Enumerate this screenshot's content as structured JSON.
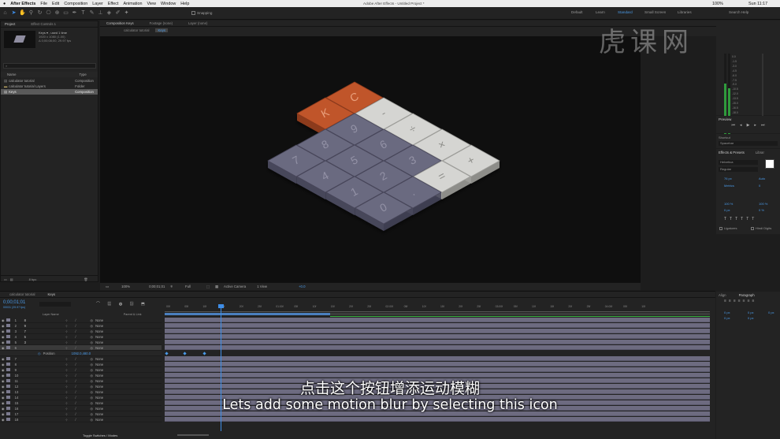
{
  "menubar": {
    "items": [
      "After Effects",
      "File",
      "Edit",
      "Composition",
      "Layer",
      "Effect",
      "Animation",
      "View",
      "Window",
      "Help"
    ],
    "title": "Adobe After Effects - Untitled Project *",
    "status": "100%",
    "clock": "Sun 11:17"
  },
  "toolbar": {
    "snapping": "Snapping",
    "workspaces": [
      "Default",
      "Learn",
      "Standard",
      "Small Screen",
      "Libraries"
    ],
    "search": "Search Help"
  },
  "project": {
    "tabs": [
      "Project",
      "Effect Controls 1"
    ],
    "item_name": "Keys ▾ , used 1 time",
    "item_size": "1920 x 1080 (1.00)",
    "item_duration": "Δ 0;00;08;00, 29.97 fps",
    "search_placeholder": "⌕",
    "col_name": "Name",
    "col_type": "Type",
    "rows": [
      {
        "name": "calculator tutorial",
        "type": "Composition"
      },
      {
        "name": "calculator tutorial Layers",
        "type": "Folder"
      },
      {
        "name": "Keys",
        "type": "Composition"
      }
    ],
    "footer": "8 bpc"
  },
  "comp": {
    "tabs": [
      "Composition Keys",
      "Footage (none)",
      "Layer (none)"
    ],
    "subtabs": [
      "calculator tutorial",
      "Keys"
    ],
    "keys": {
      "k": "K",
      "c": "C",
      "minus": "-",
      "div": "÷",
      "times": "×",
      "plus": "+",
      "eq": "=",
      "n7": "7",
      "n8": "8",
      "n9": "9",
      "n4": "4",
      "n5": "5",
      "n6": "6",
      "n1": "1",
      "n2": "2",
      "n3": "3",
      "n0": "0",
      "dot": "."
    }
  },
  "viewer": {
    "zoom": "100%",
    "time": "0;00;01;01",
    "res": "Full",
    "camera": "Active Camera",
    "views": "1 View",
    "exposure": "+0.0"
  },
  "timeline": {
    "tabs": [
      "calculator tutorial",
      "Keys"
    ],
    "timecode": "0;00;01;01",
    "fps": "00031 (29.97 fps)",
    "col_layer": "Layer Name",
    "col_parent": "Parent & Link",
    "rows": [
      {
        "num": "1",
        "name": "8",
        "parent": "None"
      },
      {
        "num": "2",
        "name": "9",
        "parent": "None"
      },
      {
        "num": "3",
        "name": "7",
        "parent": "None"
      },
      {
        "num": "4",
        "name": "5",
        "parent": "None"
      },
      {
        "num": "5",
        "name": "3",
        "parent": "None"
      },
      {
        "num": "6",
        "name": "",
        "parent": "None"
      },
      {
        "num": "7",
        "name": "",
        "parent": "None"
      },
      {
        "num": "8",
        "name": "",
        "parent": "None"
      },
      {
        "num": "9",
        "name": "",
        "parent": "None"
      },
      {
        "num": "10",
        "name": "",
        "parent": "None"
      },
      {
        "num": "11",
        "name": "",
        "parent": "None"
      },
      {
        "num": "12",
        "name": "",
        "parent": "None"
      },
      {
        "num": "13",
        "name": "",
        "parent": "None"
      },
      {
        "num": "14",
        "name": "",
        "parent": "None"
      },
      {
        "num": "15",
        "name": "",
        "parent": "None"
      },
      {
        "num": "16",
        "name": "",
        "parent": "None"
      },
      {
        "num": "17",
        "name": "",
        "parent": "None"
      },
      {
        "num": "18",
        "name": "",
        "parent": "None"
      }
    ],
    "position_label": "Position",
    "position_value": "1092.0,480.0",
    "toggle": "Toggle Switches / Modes",
    "ruler": [
      "00f",
      "05f",
      "10f",
      "15f",
      "20f",
      "25f",
      "01:00f",
      "05f",
      "10f",
      "15f",
      "20f",
      "25f",
      "02:00f",
      "05f",
      "10f",
      "15f",
      "20f",
      "25f",
      "03:00f",
      "05f",
      "10f",
      "15f",
      "20f",
      "25f",
      "04:00f",
      "05f",
      "10f"
    ]
  },
  "right": {
    "preview": "Preview",
    "shortcut": "Shortcut",
    "shortcut_value": "Spacebar",
    "effects": "Effects & Presets",
    "library": "Librar",
    "font": "Helvetica",
    "style": "Regular",
    "size": "76 px",
    "leading": "Auto",
    "tracking": "Metrics",
    "kern": "0",
    "v_scale": "100 %",
    "h_scale": "100 %",
    "baseline": "0 px",
    "tsume": "0 %",
    "ligatures": "Ligatures",
    "hindi": "Hindi Digits",
    "align": "Align",
    "paragraph": "Paragraph",
    "para_vals": [
      "0 px",
      "0 px",
      "0 px",
      "0 px",
      "0 px"
    ]
  },
  "meter": {
    "labels": [
      "0.0",
      "-1.5",
      "-3.0",
      "-4.5",
      "-6.0",
      "-7.5",
      "-9.0",
      "-10.5",
      "-12.0",
      "-13.5",
      "-15.0",
      "-16.5",
      "-18.0",
      "-19.5",
      "-21.0",
      "-22.5",
      "-24.0"
    ]
  },
  "watermark": {
    "text": "虎课网"
  },
  "subtitles": {
    "zh": "点击这个按钮增添运动模糊",
    "en": "Lets add some motion blur by selecting this icon"
  }
}
